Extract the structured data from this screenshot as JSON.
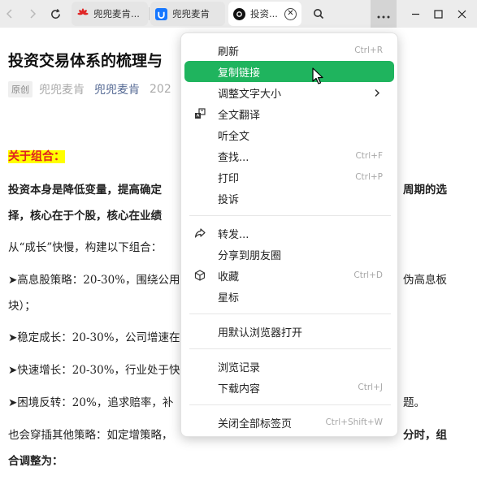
{
  "toolbar": {
    "back_icon": "chevron-left-icon",
    "forward_icon": "chevron-right-icon",
    "reload_icon": "reload-icon",
    "search_icon": "search-icon",
    "more_icon": "more-horizontal-icon",
    "minimize_icon": "minimize-icon",
    "maximize_icon": "maximize-icon",
    "close_icon": "close-icon"
  },
  "tabs": [
    {
      "label": "兜兜麦肯...",
      "favicon": "huawei-logo-icon",
      "favicon_color": "#e02626",
      "active": false
    },
    {
      "label": "兜兜麦肯",
      "favicon": "app-logo-icon",
      "favicon_color": "#1677ff",
      "active": false
    },
    {
      "label": "投资...",
      "favicon": "circle-logo-icon",
      "favicon_color": "#111111",
      "active": true
    }
  ],
  "article": {
    "title": "投资交易体系的梳理与",
    "badge": "原创",
    "author": "兜兜麦肯",
    "account": "兜兜麦肯",
    "date": "202",
    "section_heading": "关于组合：",
    "paragraphs": [
      {
        "text": "投资本身是降低变量，提高确定",
        "bold": true
      },
      {
        "text": "周期的选",
        "bold": true
      },
      {
        "text": "择，核心在于个股，核心在业绩",
        "bold": true
      },
      {
        "text": "从“成长”快慢，构建以下组合：",
        "bold": false
      },
      {
        "text": "➤高息股策略：20-30%，围绕公用",
        "bold": false
      },
      {
        "text": "伪高息板",
        "bold": false
      },
      {
        "text": "块）；",
        "bold": false
      },
      {
        "text": "➤稳定成长：20-30%，公司增速在",
        "bold": false
      },
      {
        "text": "➤快速增长：20-30%，行业处于快",
        "bold": false
      },
      {
        "text": "➤困境反转：20%，追求赔率，补",
        "bold": false
      },
      {
        "text": "题。",
        "bold": false
      },
      {
        "text": "也会穿插其他策略：如定增策略，",
        "bold": false
      },
      {
        "text": "分时，组",
        "bold": true
      },
      {
        "text": "合调整为：",
        "bold": true
      }
    ]
  },
  "menu": {
    "items": [
      {
        "label": "刷新",
        "shortcut": "Ctrl+R",
        "icon": "",
        "highlight": false
      },
      {
        "label": "复制链接",
        "shortcut": "",
        "icon": "",
        "highlight": true
      },
      {
        "label": "调整文字大小",
        "shortcut": "",
        "icon": "",
        "highlight": false,
        "submenu_icon": "chevron-right-icon"
      },
      {
        "label": "全文翻译",
        "shortcut": "",
        "icon": "translate-icon",
        "highlight": false
      },
      {
        "label": "听全文",
        "shortcut": "",
        "icon": "",
        "highlight": false
      },
      {
        "label": "查找...",
        "shortcut": "Ctrl+F",
        "icon": "",
        "highlight": false
      },
      {
        "label": "打印",
        "shortcut": "Ctrl+P",
        "icon": "",
        "highlight": false
      },
      {
        "label": "投诉",
        "shortcut": "",
        "icon": "",
        "highlight": false
      },
      {
        "label": "转发...",
        "shortcut": "",
        "icon": "share-icon",
        "highlight": false
      },
      {
        "label": "分享到朋友圈",
        "shortcut": "",
        "icon": "",
        "highlight": false
      },
      {
        "label": "收藏",
        "shortcut": "Ctrl+D",
        "icon": "cube-icon",
        "highlight": false
      },
      {
        "label": "星标",
        "shortcut": "",
        "icon": "",
        "highlight": false
      },
      {
        "label": "用默认浏览器打开",
        "shortcut": "",
        "icon": "",
        "highlight": false
      },
      {
        "label": "浏览记录",
        "shortcut": "",
        "icon": "",
        "highlight": false
      },
      {
        "label": "下载内容",
        "shortcut": "Ctrl+J",
        "icon": "",
        "highlight": false
      },
      {
        "label": "关闭全部标签页",
        "shortcut": "Ctrl+Shift+W",
        "icon": "",
        "highlight": false
      }
    ],
    "highlight_color": "#1fb45e"
  },
  "colors": {
    "titlebar": "#ececec",
    "heading_highlight": "#ffff00",
    "heading_text": "#e02020",
    "account_link": "#576b95"
  }
}
